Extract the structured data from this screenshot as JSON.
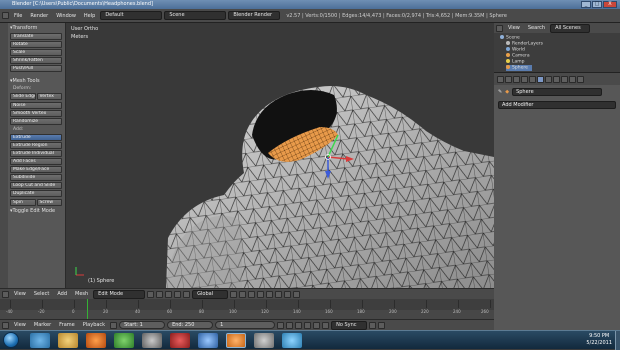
{
  "window": {
    "title": "Blender [C:\\Users\\Public\\Documents\\Headphones.blend]",
    "buttons": [
      "_",
      "□",
      "X"
    ]
  },
  "info_header": {
    "menus": [
      "File",
      "Render",
      "Window",
      "Help"
    ],
    "layout": "Default",
    "scene": "Scene",
    "engine": "Blender Render",
    "stats": "v2.57 | Verts:0/1500 | Edges:14/4,473 | Faces:0/2,974 | Tris:4,652 | Mem:9.35M | Sphere"
  },
  "toolshelf": {
    "transform_panel": "Transform",
    "transform_tools": [
      "Translate",
      "Rotate",
      "Scale",
      "Shrink/Fatten",
      "Push/Pull"
    ],
    "mesh_tools_panel": "Mesh Tools",
    "deform_label": "Deform:",
    "deform_row": [
      "Slide Edge",
      "Vertex"
    ],
    "deform_tools": [
      "Noise",
      "Smooth Vertex",
      "Randomize"
    ],
    "add_label": "Add:",
    "add_tools": [
      "Extrude",
      "Extrude Region",
      "Extrude Individual",
      "Add Faces",
      "Make Edge/Face",
      "Subdivide",
      "Loop Cut and Slide",
      "Duplicate"
    ],
    "bottom_row": [
      "Spin",
      "Screw"
    ],
    "toggle_panel": "Toggle Edit Mode"
  },
  "viewport": {
    "view_label": "User Ortho",
    "units_label": "Meters",
    "object_label": "(1) Sphere"
  },
  "view3d_header": {
    "menus": [
      "View",
      "Select",
      "Add",
      "Mesh"
    ],
    "mode": "Edit Mode",
    "pivot": "Global"
  },
  "timeline": {
    "ticks": [
      "-40",
      "-20",
      "0",
      "20",
      "40",
      "60",
      "80",
      "100",
      "120",
      "140",
      "160",
      "180",
      "200",
      "220",
      "240",
      "260"
    ],
    "current_frame": 1
  },
  "timeline_header": {
    "menus": [
      "View",
      "Marker",
      "Frame",
      "Playback"
    ],
    "start": "Start: 1",
    "end": "End: 250",
    "current": "1",
    "sync": "No Sync"
  },
  "outliner": {
    "view": "View",
    "search": "Search",
    "filter": "All Scenes",
    "items": [
      "Scene",
      "RenderLayers",
      "World",
      "Camera",
      "Lamp",
      "Sphere"
    ]
  },
  "properties": {
    "object_name": "Sphere",
    "add_modifier": "Add Modifier"
  },
  "taskbar": {
    "time": "9:50 PM",
    "date": "5/22/2011"
  },
  "colors": {
    "accent_orange": "#e89a4a",
    "selection_blue": "#5a7cae",
    "timeline_cursor": "#35b235"
  }
}
